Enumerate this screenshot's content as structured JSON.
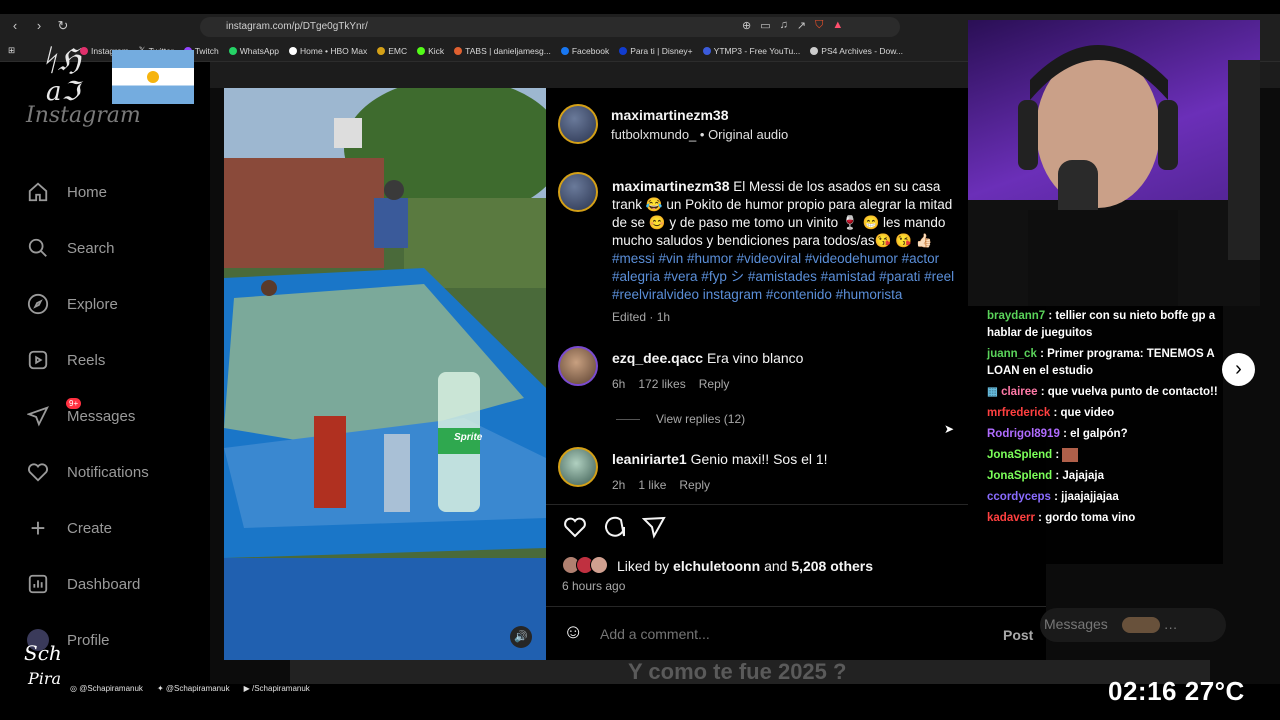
{
  "browser": {
    "url": "instagram.com/p/DTge0gTkYnr/",
    "bookmarks": [
      "Tu...",
      "Instagram",
      "Twitter",
      "Twitch",
      "WhatsApp",
      "Home • HBO Max",
      "EMC",
      "Kick",
      "TABS | danieljamesg...",
      "Facebook",
      "Para ti | Disney+",
      "YTMP3 - Free YouTu...",
      "PS4 Archives - Dow..."
    ]
  },
  "sidebar": {
    "logo": "Instagram",
    "items": [
      {
        "label": "Home"
      },
      {
        "label": "Search"
      },
      {
        "label": "Explore"
      },
      {
        "label": "Reels"
      },
      {
        "label": "Messages",
        "badge": "9+"
      },
      {
        "label": "Notifications"
      },
      {
        "label": "Create"
      },
      {
        "label": "Dashboard"
      },
      {
        "label": "Profile"
      }
    ]
  },
  "post": {
    "author": "maxi­martinezm38",
    "audio_user": "futbolxmundo_",
    "audio_label": "Original audio",
    "caption_user": "maximartinezm38",
    "caption_text": "El Messi de los asados en su casa trank 😂 un Pokito de humor propio para alegrar la mitad de se 😊 y de paso me tomo un vinito 🍷 😁 les mando mucho saludos y bendiciones para todos/as😘 😘 👍🏻",
    "hashtags": "#messi #vin #humor #videoviral #videodehumor #actor #alegria #vera #fyp シ #amistades #amistad #parati #reel #reelviralvideo instagram #contenido #humorista",
    "edited": "Edited · 1h",
    "comments": [
      {
        "user": "ezq_dee.qacc",
        "text": "Era vino blanco",
        "time": "6h",
        "likes": "172 likes",
        "reply": "Reply",
        "view_replies": "View replies (12)"
      },
      {
        "user": "leaniriarte1",
        "text": "Genio maxi!! Sos el 1!",
        "time": "2h",
        "likes": "1 like",
        "reply": "Reply"
      }
    ],
    "liked_by_prefix": "Liked by",
    "liked_by_user": "elchuletoonn",
    "liked_by_and": "and",
    "liked_by_others": "5,208 others",
    "posted_ago": "6 hours ago",
    "comment_placeholder": "Add a comment...",
    "post_button": "Post"
  },
  "media_labels": {
    "bottle": "Sprite"
  },
  "chat": [
    {
      "user": "braydann7",
      "text": ": tellier con su nieto boffe gp a hablar de jueguitos",
      "color": "#5ad35a"
    },
    {
      "user": "juann_ck",
      "text": ": Primer programa: TENEMOS A LOAN en el estudio",
      "color": "#5ad35a"
    },
    {
      "user": "clairee",
      "text": ": que vuelva punto de contacto!!",
      "color": "#ff7aa8"
    },
    {
      "user": "mrfrederick",
      "text": ": que video",
      "color": "#ff4040"
    },
    {
      "user": "Rodrigol8919",
      "text": ": el galpón?",
      "color": "#b06cff"
    },
    {
      "user": "JonaSplend",
      "text": ":",
      "color": "#7cff5a"
    },
    {
      "user": "JonaSplend",
      "text": ": Jajajaja",
      "color": "#7cff5a"
    },
    {
      "user": "ccordyceps",
      "text": ": jjaajajjajaa",
      "color": "#8a6cff"
    },
    {
      "user": "kadaverr",
      "text": ": gordo toma vino",
      "color": "#ff4040"
    }
  ],
  "overlay": {
    "messages_pill": "Messages",
    "bottom_banner": "Y como te fue 2025 ?",
    "socials": [
      "@Schapiramanuk",
      "@Schapiramanuk",
      "/Schapiramanuk"
    ],
    "clock": "02:16",
    "temperature": "27°C"
  }
}
